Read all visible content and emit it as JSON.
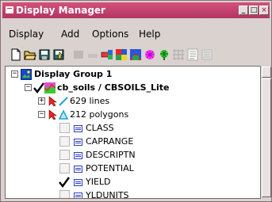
{
  "window": {
    "title": "Display Manager",
    "buttons": [
      "_",
      "□",
      "×"
    ]
  },
  "menu": [
    "Display",
    "Add",
    "Options",
    "Help"
  ],
  "toolbar": [
    "new-icon",
    "open-icon",
    "save-icon",
    "load-icon",
    "disabled-icon",
    "disabled-icon",
    "add-layer-icon",
    "raster-icon",
    "rgb-icon",
    "vector-icon",
    "grid-icon",
    "nviz-icon",
    "table-icon",
    "disabled-icon"
  ],
  "tree": {
    "group": "Display Group 1",
    "layer": "cb_soils / CBSOILS_Lite",
    "lines": "629 lines",
    "polygons": "212 polygons",
    "attributes": [
      {
        "name": "CLASS",
        "checked": false
      },
      {
        "name": "CAPRANGE",
        "checked": false
      },
      {
        "name": "DESCRIPTN",
        "checked": false
      },
      {
        "name": "POTENTIAL",
        "checked": false
      },
      {
        "name": "YIELD",
        "checked": true
      },
      {
        "name": "YLDUNITS",
        "checked": false
      }
    ]
  },
  "colors": {
    "title_bar": "#c0406c",
    "window_bg": "#d9d2cf",
    "tree_bg": "#ffffff"
  }
}
